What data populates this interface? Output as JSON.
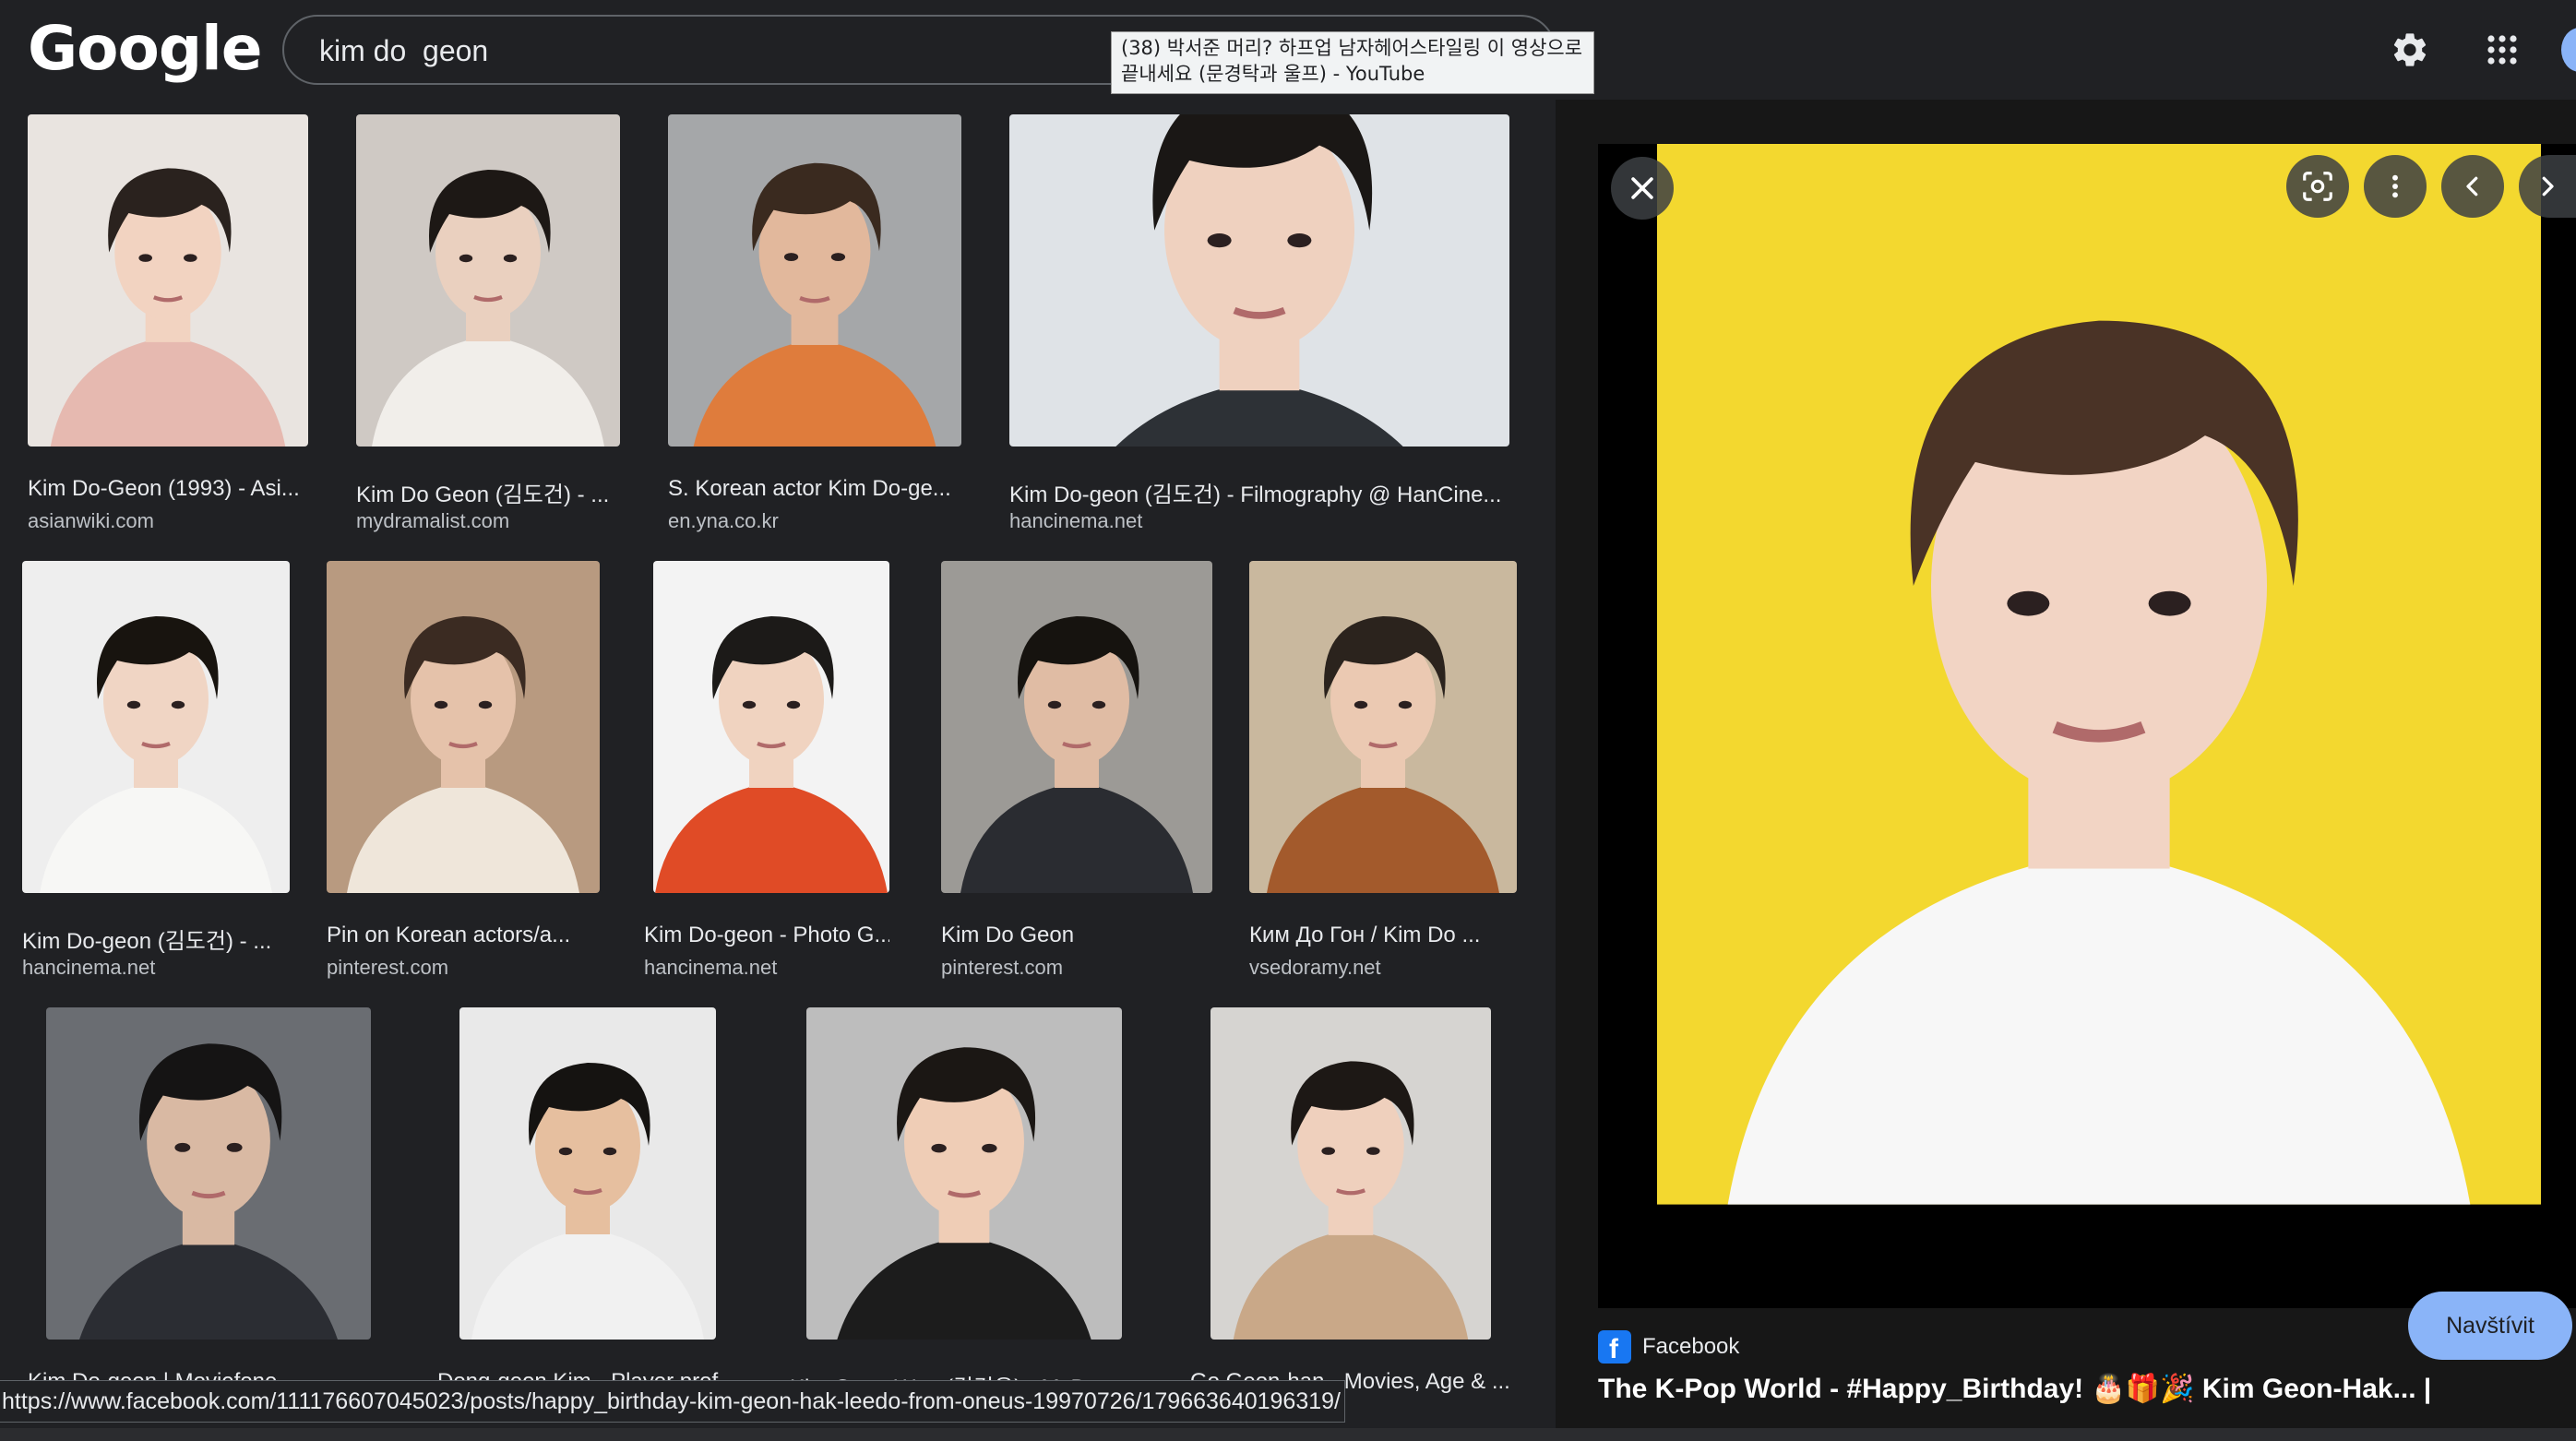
{
  "header": {
    "logo": "Google",
    "search_value": "kim do  geon",
    "tooltip": "(38) 박서준 머리? 하프업 남자헤어스타일링 이 영상으로 끝내세요 (문경탁과 울프) - YouTube",
    "settings_icon": "gear-icon",
    "apps_icon": "apps-grid-icon"
  },
  "results": [
    {
      "title": "Kim Do-Geon (1993) - Asi...",
      "source": "asianwiki.com",
      "bg": "#e9e4e0",
      "skin": "#f2d3c1",
      "hair": "#2a221e",
      "cloth": "#e6b9b0"
    },
    {
      "title": "Kim Do Geon (김도건) - ...",
      "source": "mydramalist.com",
      "bg": "#cfc9c4",
      "skin": "#ead0bf",
      "hair": "#1d1815",
      "cloth": "#f1eeea"
    },
    {
      "title": "S. Korean actor Kim Do-ge...",
      "source": "en.yna.co.kr",
      "bg": "#a5a7a9",
      "skin": "#e2b89c",
      "hair": "#3a2a1f",
      "cloth": "#df7c3c"
    },
    {
      "title": "Kim Do-geon (김도건) - Filmography @ HanCine...",
      "source": "hancinema.net",
      "bg": "#dfe3e7",
      "skin": "#efd1bf",
      "hair": "#1a1715",
      "cloth": "#2d3136"
    },
    {
      "title": "Kim Do-geon (김도건) - ...",
      "source": "hancinema.net",
      "bg": "#eeeeee",
      "skin": "#f0d5c4",
      "hair": "#18140f",
      "cloth": "#f7f7f5"
    },
    {
      "title": "Pin on Korean actors/a...",
      "source": "pinterest.com",
      "bg": "#b89a80",
      "skin": "#e5c2aa",
      "hair": "#3b2b22",
      "cloth": "#efe6da"
    },
    {
      "title": "Kim Do-geon - Photo G...",
      "source": "hancinema.net",
      "bg": "#f3f3f3",
      "skin": "#f0d3c0",
      "hair": "#1c1a18",
      "cloth": "#e04b26"
    },
    {
      "title": "Kim Do Geon",
      "source": "pinterest.com",
      "bg": "#9c9a96",
      "skin": "#e0bca4",
      "hair": "#16130f",
      "cloth": "#2a2c31"
    },
    {
      "title": "Ким До Гон / Kim Do ...",
      "source": "vsedoramy.net",
      "bg": "#c9b89e",
      "skin": "#ebc9b2",
      "hair": "#2b231d",
      "cloth": "#a35a2c"
    },
    {
      "title": "Kim Do-geon | Moviefone",
      "source": "",
      "bg": "#6a6d72",
      "skin": "#d9b9a3",
      "hair": "#151414",
      "cloth": "#2b2d33"
    },
    {
      "title": "Dong-geon Kim - Player prof...",
      "source": "",
      "bg": "#e9e9e9",
      "skin": "#e6bf9f",
      "hair": "#151311",
      "cloth": "#f1f1f1"
    },
    {
      "title": "Kim Geon Woo (김건우) - MyDra...",
      "source": "",
      "bg": "#bdbdbd",
      "skin": "#efcdb6",
      "hair": "#1b1714",
      "cloth": "#1c1c1c"
    },
    {
      "title": "Go Geon-han - Movies, Age & ...",
      "source": "",
      "bg": "#d6d4d1",
      "skin": "#efd0bd",
      "hair": "#1d1815",
      "cloth": "#c9a888"
    }
  ],
  "status_url": "https://www.facebook.com/111176607045023/posts/happy_birthday-kim-geon-hak-leedo-from-oneus-19970726/179663640196319/",
  "preview": {
    "source": "Facebook",
    "title": "The K-Pop World - #Happy_Birthday! 🎂🎁🎉 Kim Geon-Hak... |",
    "visit": "Navštívit",
    "bg": "#f3d82f",
    "skin": "#f2d4c4",
    "hair": "#4a3326",
    "cloth": "#f7f7f7"
  }
}
